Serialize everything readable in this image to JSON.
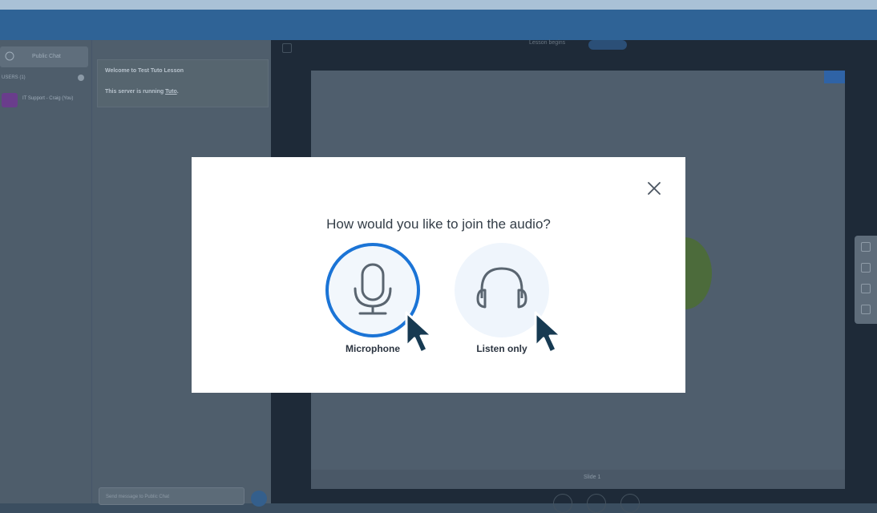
{
  "chat": {
    "public_chat_label": "Public Chat",
    "users_header": "USERS (1)",
    "user_name": "IT Support - Craig (You)",
    "welcome_line1": "Welcome to Test Tuto Lesson",
    "welcome_line2_prefix": "This server is running ",
    "welcome_line2_link": "Tuto",
    "welcome_line2_suffix": ".",
    "input_placeholder": "Send message to Public Chat"
  },
  "stage": {
    "recording_label": "Lesson begins",
    "slide_label": "Slide 1"
  },
  "modal": {
    "title": "How would you like to join the audio?",
    "microphone_label": "Microphone",
    "listen_only_label": "Listen only",
    "accent_color": "#1b74d6"
  },
  "icons": [
    "close-icon",
    "microphone-icon",
    "headphones-icon",
    "cursor-pointer-icon"
  ]
}
